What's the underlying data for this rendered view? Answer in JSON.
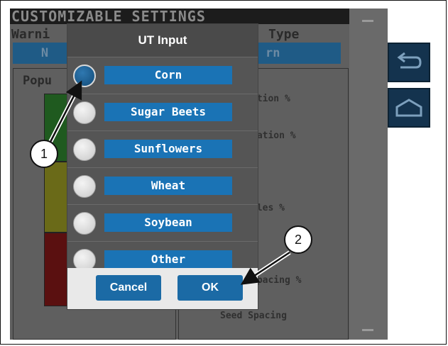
{
  "background": {
    "title": "CUSTOMIZABLE SETTINGS",
    "warning_label": "Warni",
    "warning_value": "N",
    "type_label": "Type",
    "type_value": "rn",
    "population_label": "Popu",
    "metrics": [
      "ation %",
      "lation %",
      "%",
      "ples %",
      "Spacing %",
      "Seed Spacing"
    ],
    "side_buttons": [
      {
        "icon": "return-arrow-icon"
      },
      {
        "icon": "home-icon"
      }
    ],
    "colors": {
      "screen": "#5f5f5f",
      "field": "#1f5b86",
      "side_button": "#14334e"
    }
  },
  "dialog": {
    "title": "UT Input",
    "options": [
      {
        "label": "Corn",
        "selected": true
      },
      {
        "label": "Sugar Beets",
        "selected": false
      },
      {
        "label": "Sunflowers",
        "selected": false
      },
      {
        "label": "Wheat",
        "selected": false
      },
      {
        "label": "Soybean",
        "selected": false
      },
      {
        "label": "Other",
        "selected": false
      }
    ],
    "cancel_label": "Cancel",
    "ok_label": "OK",
    "colors": {
      "option_label": "#1a73b5",
      "button": "#1b6aa5",
      "footer": "#e9e9e9"
    }
  },
  "callouts": [
    {
      "number": "1"
    },
    {
      "number": "2"
    }
  ]
}
